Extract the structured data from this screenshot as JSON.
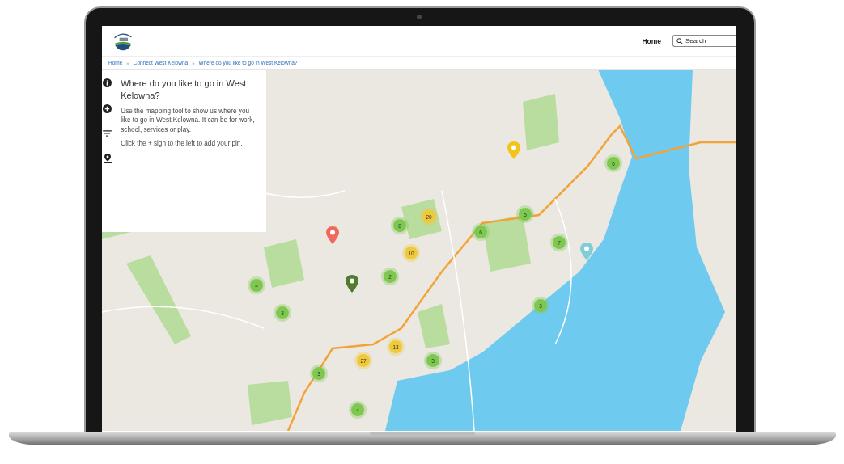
{
  "header": {
    "nav_link": "Home",
    "search": {
      "placeholder": "Search"
    }
  },
  "breadcrumbs": [
    {
      "label": "Home"
    },
    {
      "separator": "»",
      "label": "Connect West Kelowna"
    },
    {
      "separator": "»",
      "label": "Where do you like to go in West Kelowna?"
    }
  ],
  "info_panel": {
    "title": "Where do you like to go in West Kelowna?",
    "paragraphs": [
      "Use the mapping tool to show us where you like to go in West Kelowna. It can be for work, school, services or play.",
      "Click the + sign to the left to add your pin."
    ]
  },
  "map": {
    "clusters": [
      {
        "count": "4",
        "color": "#7ec850"
      },
      {
        "count": "3",
        "color": "#7ec850"
      },
      {
        "count": "3",
        "color": "#7ec850"
      },
      {
        "count": "4",
        "color": "#7ec850"
      },
      {
        "count": "27",
        "color": "#f0c93a"
      },
      {
        "count": "13",
        "color": "#f0c93a"
      },
      {
        "count": "3",
        "color": "#7ec850"
      },
      {
        "count": "2",
        "color": "#7ec850"
      },
      {
        "count": "10",
        "color": "#f0c93a"
      },
      {
        "count": "20",
        "color": "#f0c93a"
      },
      {
        "count": "8",
        "color": "#7ec850"
      },
      {
        "count": "6",
        "color": "#7ec850"
      },
      {
        "count": "5",
        "color": "#7ec850"
      },
      {
        "count": "7",
        "color": "#7ec850"
      },
      {
        "count": "3",
        "color": "#7ec850"
      },
      {
        "count": "6",
        "color": "#7ec850"
      }
    ],
    "pins": [
      {
        "color": "#f0685e"
      },
      {
        "color": "#4f7d2b"
      },
      {
        "color": "#f2c418"
      },
      {
        "color": "#7fcdd6"
      }
    ]
  }
}
